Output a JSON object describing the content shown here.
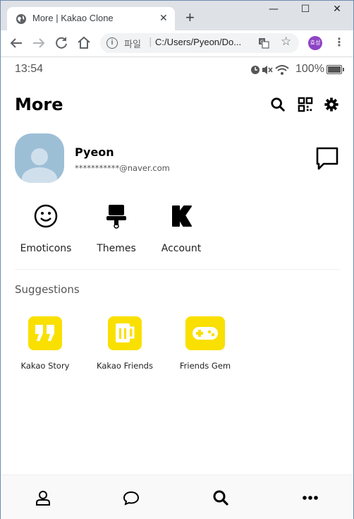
{
  "browser": {
    "tab_title": "More | Kakao Clone",
    "tab_close": "✕",
    "new_tab": "+",
    "window_controls": {
      "minimize": "—",
      "maximize": "☐",
      "close": "✕"
    },
    "address": {
      "scheme_label": "파일",
      "separator": "|",
      "url": "C:/Users/Pyeon/Do..."
    },
    "profile_initials": "효성",
    "icons": [
      "globe-icon",
      "back-arrow-icon",
      "forward-arrow-icon",
      "reload-icon",
      "home-icon",
      "info-icon",
      "translate-icon",
      "star-icon",
      "kebab-menu-icon"
    ]
  },
  "status_bar": {
    "time": "13:54",
    "battery": "100%",
    "battery_level": 1.0,
    "icons": [
      "clock-icon",
      "mute-icon",
      "wifi-icon",
      "battery-icon"
    ]
  },
  "header": {
    "title": "More",
    "icons": [
      "search-icon",
      "qr-code-icon",
      "gear-icon"
    ]
  },
  "profile": {
    "name": "Pyeon",
    "email": "***********@naver.com"
  },
  "shortcuts": [
    {
      "label": "Emoticons",
      "icon": "smiley-icon"
    },
    {
      "label": "Themes",
      "icon": "paintbrush-icon"
    },
    {
      "label": "Account",
      "icon": "kakao-k-icon"
    }
  ],
  "suggestions": {
    "title": "Suggestions",
    "items": [
      {
        "label": "Kakao Story",
        "icon": "quote-icon"
      },
      {
        "label": "Kakao Friends",
        "icon": "mug-icon"
      },
      {
        "label": "Friends Gem",
        "icon": "gamepad-icon"
      }
    ]
  },
  "tabbar": {
    "icons": [
      "user-icon",
      "chat-bubble-icon",
      "search-icon",
      "more-dots-icon"
    ]
  },
  "colors": {
    "accent_yellow": "#f9e000",
    "avatar_bg": "#9dbfd6",
    "chrome_frame": "#dee1e6",
    "profile_badge": "#8e44c6"
  }
}
